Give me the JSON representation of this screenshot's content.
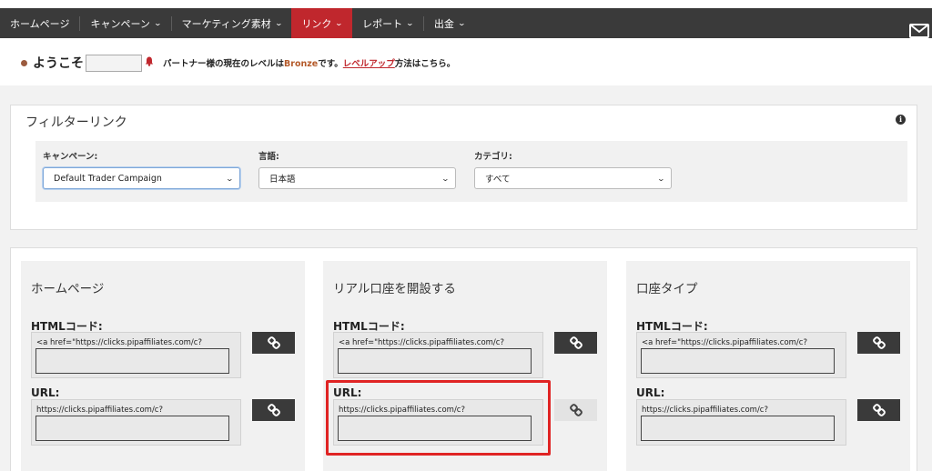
{
  "nav": {
    "items": [
      {
        "label": "ホームページ",
        "has_dropdown": false,
        "active": false
      },
      {
        "label": "キャンペーン",
        "has_dropdown": true,
        "active": false
      },
      {
        "label": "マーケティング素材",
        "has_dropdown": true,
        "active": false
      },
      {
        "label": "リンク",
        "has_dropdown": true,
        "active": true
      },
      {
        "label": "レポート",
        "has_dropdown": true,
        "active": false
      },
      {
        "label": "出金",
        "has_dropdown": true,
        "active": false
      }
    ],
    "chevron_icon": "chevron-down-icon",
    "mail_icon": "mail-icon",
    "active_color": "#c0272d",
    "bar_color": "#3a3a3a"
  },
  "welcome": {
    "title": "ようこそ",
    "bell_icon": "bell-icon",
    "text_before": "パートナー様の現在のレベルは",
    "level": "Bronze",
    "text_middle": "です。",
    "level_up_link": "レベルアップ",
    "text_after": "方法はこちら。"
  },
  "filter": {
    "title": "フィルターリンク",
    "info_icon": "info-icon",
    "info_glyph": "i",
    "campaign_label": "キャンペーン:",
    "campaign_value": "Default Trader Campaign",
    "language_label": "言語:",
    "language_value": "日本語",
    "category_label": "カテゴリ:",
    "category_value": "すべて"
  },
  "cards": [
    {
      "title": "ホームページ",
      "html_label": "HTMLコード:",
      "html_code": "<a href=\"https://clicks.pipaffiliates.com/c?",
      "url_label": "URL:",
      "url_value": "https://clicks.pipaffiliates.com/c?"
    },
    {
      "title": "リアル口座を開設する",
      "html_label": "HTMLコード:",
      "html_code": "<a href=\"https://clicks.pipaffiliates.com/c?",
      "url_label": "URL:",
      "url_value": "https://clicks.pipaffiliates.com/c?"
    },
    {
      "title": "口座タイプ",
      "html_label": "HTMLコード:",
      "html_code": "<a href=\"https://clicks.pipaffiliates.com/c?",
      "url_label": "URL:",
      "url_value": "https://clicks.pipaffiliates.com/c?"
    }
  ],
  "link_button_icon": "link-icon",
  "highlight_color": "#e02424"
}
